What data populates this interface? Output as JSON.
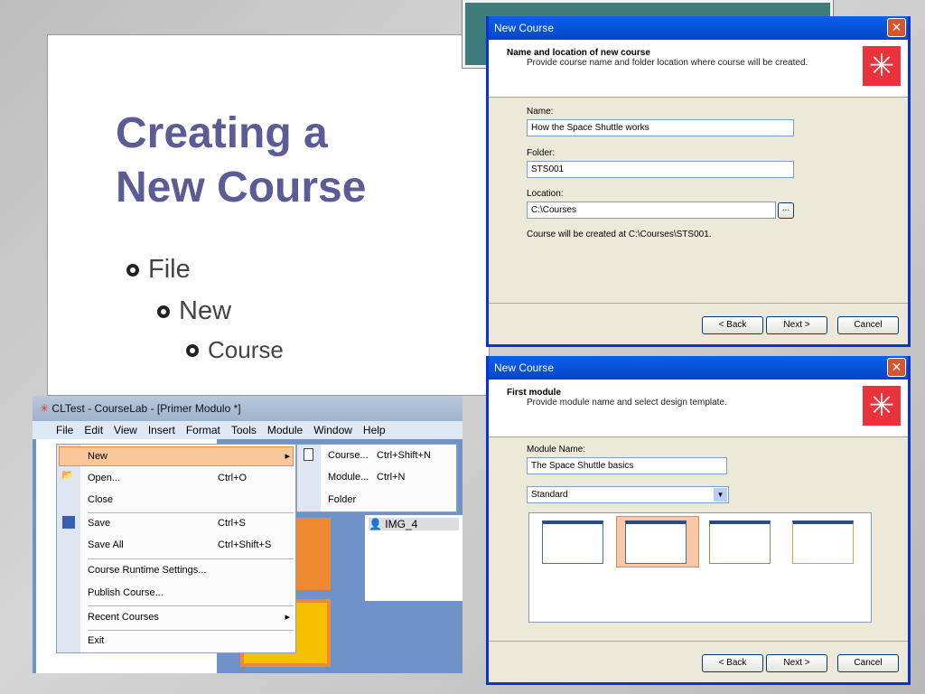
{
  "slide": {
    "title_line1": "Creating a",
    "title_line2": "New Course",
    "bullets": [
      "File",
      "New",
      "Course"
    ]
  },
  "dialog1": {
    "title": "New Course",
    "header_title": "Name and location of new course",
    "header_desc": "Provide course name and folder location where course will be created.",
    "name_label": "Name:",
    "name_value": "How the Space Shuttle works",
    "folder_label": "Folder:",
    "folder_value": "STS001",
    "location_label": "Location:",
    "location_value": "C:\\Courses",
    "browse": "...",
    "info": "Course will be created at C:\\Courses\\STS001.",
    "back": "< Back",
    "next": "Next >",
    "cancel": "Cancel"
  },
  "dialog2": {
    "title": "New Course",
    "header_title": "First module",
    "header_desc": "Provide module name and select design template.",
    "module_label": "Module Name:",
    "module_value": "The Space Shuttle basics",
    "template_value": "Standard",
    "back": "< Back",
    "next": "Next >",
    "cancel": "Cancel"
  },
  "app": {
    "title": "CLTest - CourseLab - [Primer Modulo *]",
    "menus": [
      "File",
      "Edit",
      "View",
      "Insert",
      "Format",
      "Tools",
      "Module",
      "Window",
      "Help"
    ],
    "file_menu": [
      {
        "label": "New",
        "shortcut": ""
      },
      {
        "label": "Open...",
        "shortcut": "Ctrl+O"
      },
      {
        "label": "Close",
        "shortcut": ""
      },
      {
        "label": "Save",
        "shortcut": "Ctrl+S"
      },
      {
        "label": "Save All",
        "shortcut": "Ctrl+Shift+S"
      },
      {
        "label": "Course Runtime Settings...",
        "shortcut": ""
      },
      {
        "label": "Publish Course...",
        "shortcut": ""
      },
      {
        "label": "Recent Courses",
        "shortcut": ""
      },
      {
        "label": "Exit",
        "shortcut": ""
      }
    ],
    "new_submenu": [
      {
        "label": "Course...",
        "shortcut": "Ctrl+Shift+N"
      },
      {
        "label": "Module...",
        "shortcut": "Ctrl+N"
      },
      {
        "label": "Folder",
        "shortcut": ""
      }
    ],
    "object_label": "IMG_4"
  },
  "colors": {
    "title": "#5b5b95",
    "xp_blue": "#0a5fe8",
    "highlight": "#f9c79b"
  }
}
